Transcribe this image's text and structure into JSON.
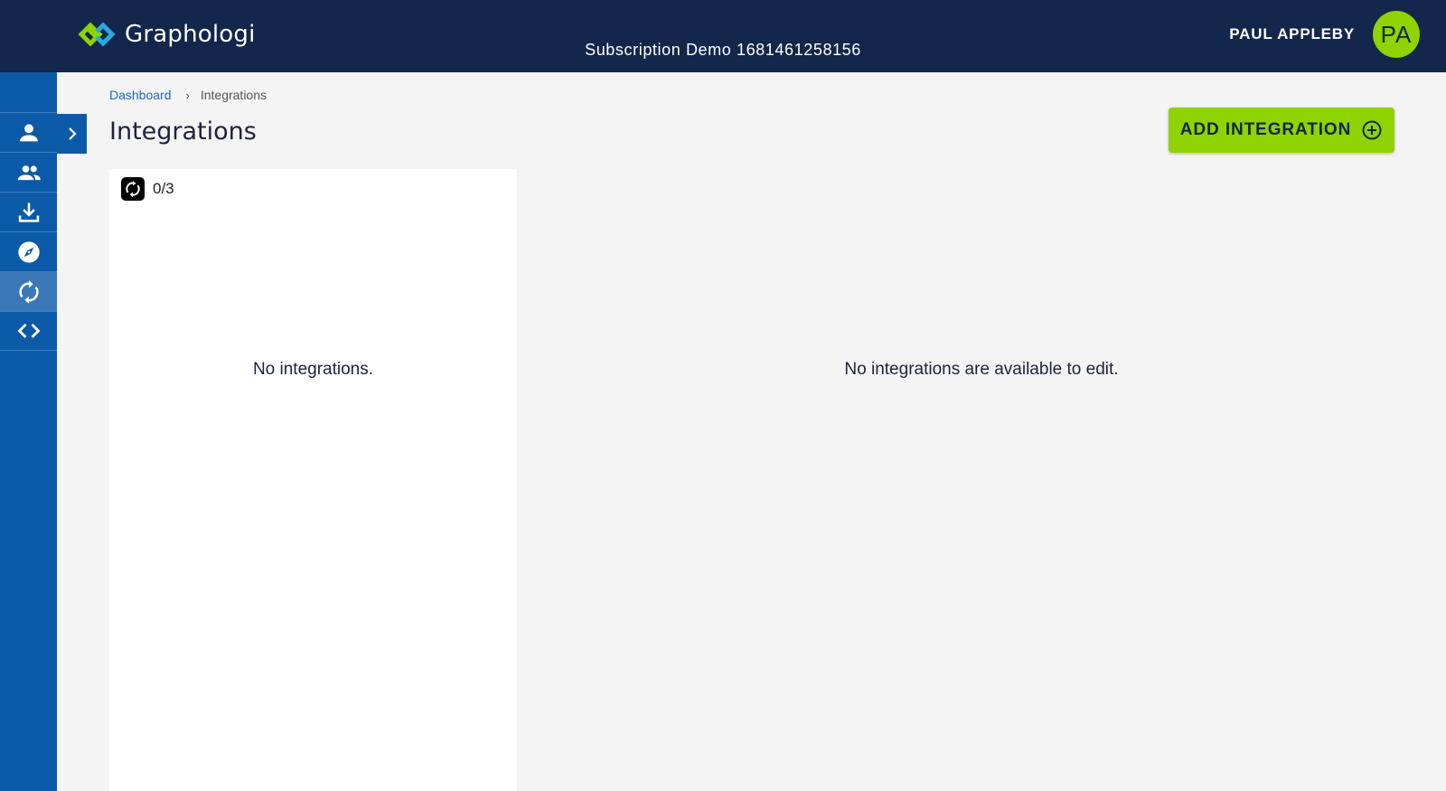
{
  "header": {
    "app_name": "Graphologi",
    "subscription_title": "Subscription Demo 1681461258156",
    "user_name": "PAUL APPLEBY",
    "user_initials": "PA",
    "logo_icon": "graphologi-logo-icon"
  },
  "sidebar": {
    "items": [
      {
        "name": "user-icon",
        "active": false
      },
      {
        "name": "users-icon",
        "active": false
      },
      {
        "name": "download-icon",
        "active": false
      },
      {
        "name": "compass-icon",
        "active": false
      },
      {
        "name": "sync-icon",
        "active": true
      },
      {
        "name": "code-icon",
        "active": false
      }
    ],
    "expand_icon": "chevron-right-icon"
  },
  "breadcrumb": {
    "items": [
      "Dashboard",
      "Integrations"
    ],
    "separator_icon": "chevron-right-icon"
  },
  "page": {
    "title": "Integrations",
    "add_button_label": "ADD INTEGRATION",
    "add_button_icon": "add-circle-icon"
  },
  "list_panel": {
    "count": "0/3",
    "count_icon": "sync-icon",
    "empty_message": "No integrations."
  },
  "detail_panel": {
    "empty_message": "No integrations are available to edit."
  },
  "colors": {
    "header_bg": "#13264b",
    "sidebar_bg": "#0b5aa8",
    "sidebar_active": "#3b78b8",
    "accent_green": "#8fd300",
    "link_blue": "#1a67c4",
    "page_bg": "#f4f4f4"
  }
}
